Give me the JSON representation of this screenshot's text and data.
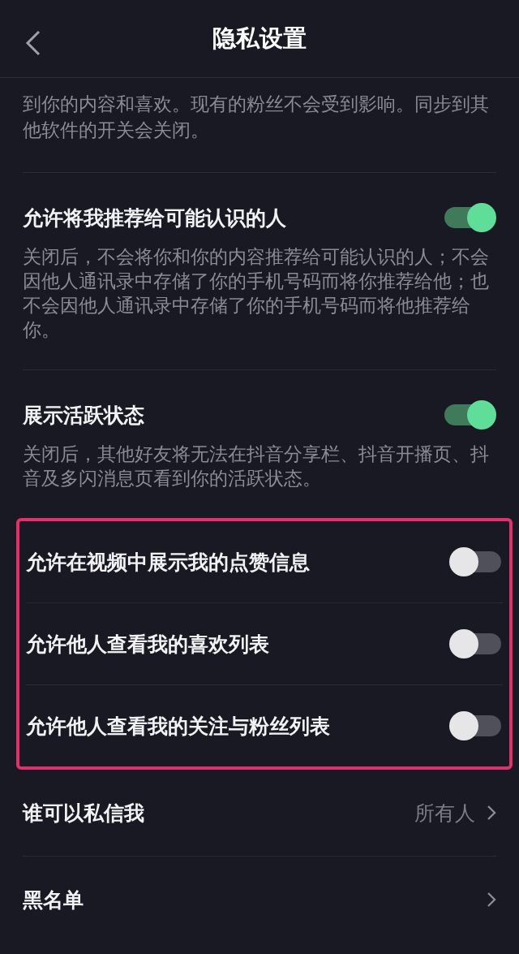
{
  "header": {
    "title": "隐私设置"
  },
  "intro": {
    "text": "到你的内容和喜欢。现有的粉丝不会受到影响。同步到其他软件的开关会关闭。"
  },
  "settings": [
    {
      "kind": "toggle",
      "label": "允许将我推荐给可能认识的人",
      "on": true,
      "description": "关闭后，不会将你和你的内容推荐给可能认识的人；不会因他人通讯录中存储了你的手机号码而将你推荐给他；也不会因他人通讯录中存储了你的手机号码而将他推荐给你。"
    },
    {
      "kind": "toggle",
      "label": "展示活跃状态",
      "on": true,
      "description": "关闭后，其他好友将无法在抖音分享栏、抖音开播页、抖音及多闪消息页看到你的活跃状态。"
    }
  ],
  "highlighted_settings": [
    {
      "kind": "toggle",
      "label": "允许在视频中展示我的点赞信息",
      "on": false
    },
    {
      "kind": "toggle",
      "label": "允许他人查看我的喜欢列表",
      "on": false
    },
    {
      "kind": "toggle",
      "label": "允许他人查看我的关注与粉丝列表",
      "on": false
    }
  ],
  "more_settings": [
    {
      "kind": "link",
      "label": "谁可以私信我",
      "value": "所有人"
    },
    {
      "kind": "link",
      "label": "黑名单"
    }
  ]
}
